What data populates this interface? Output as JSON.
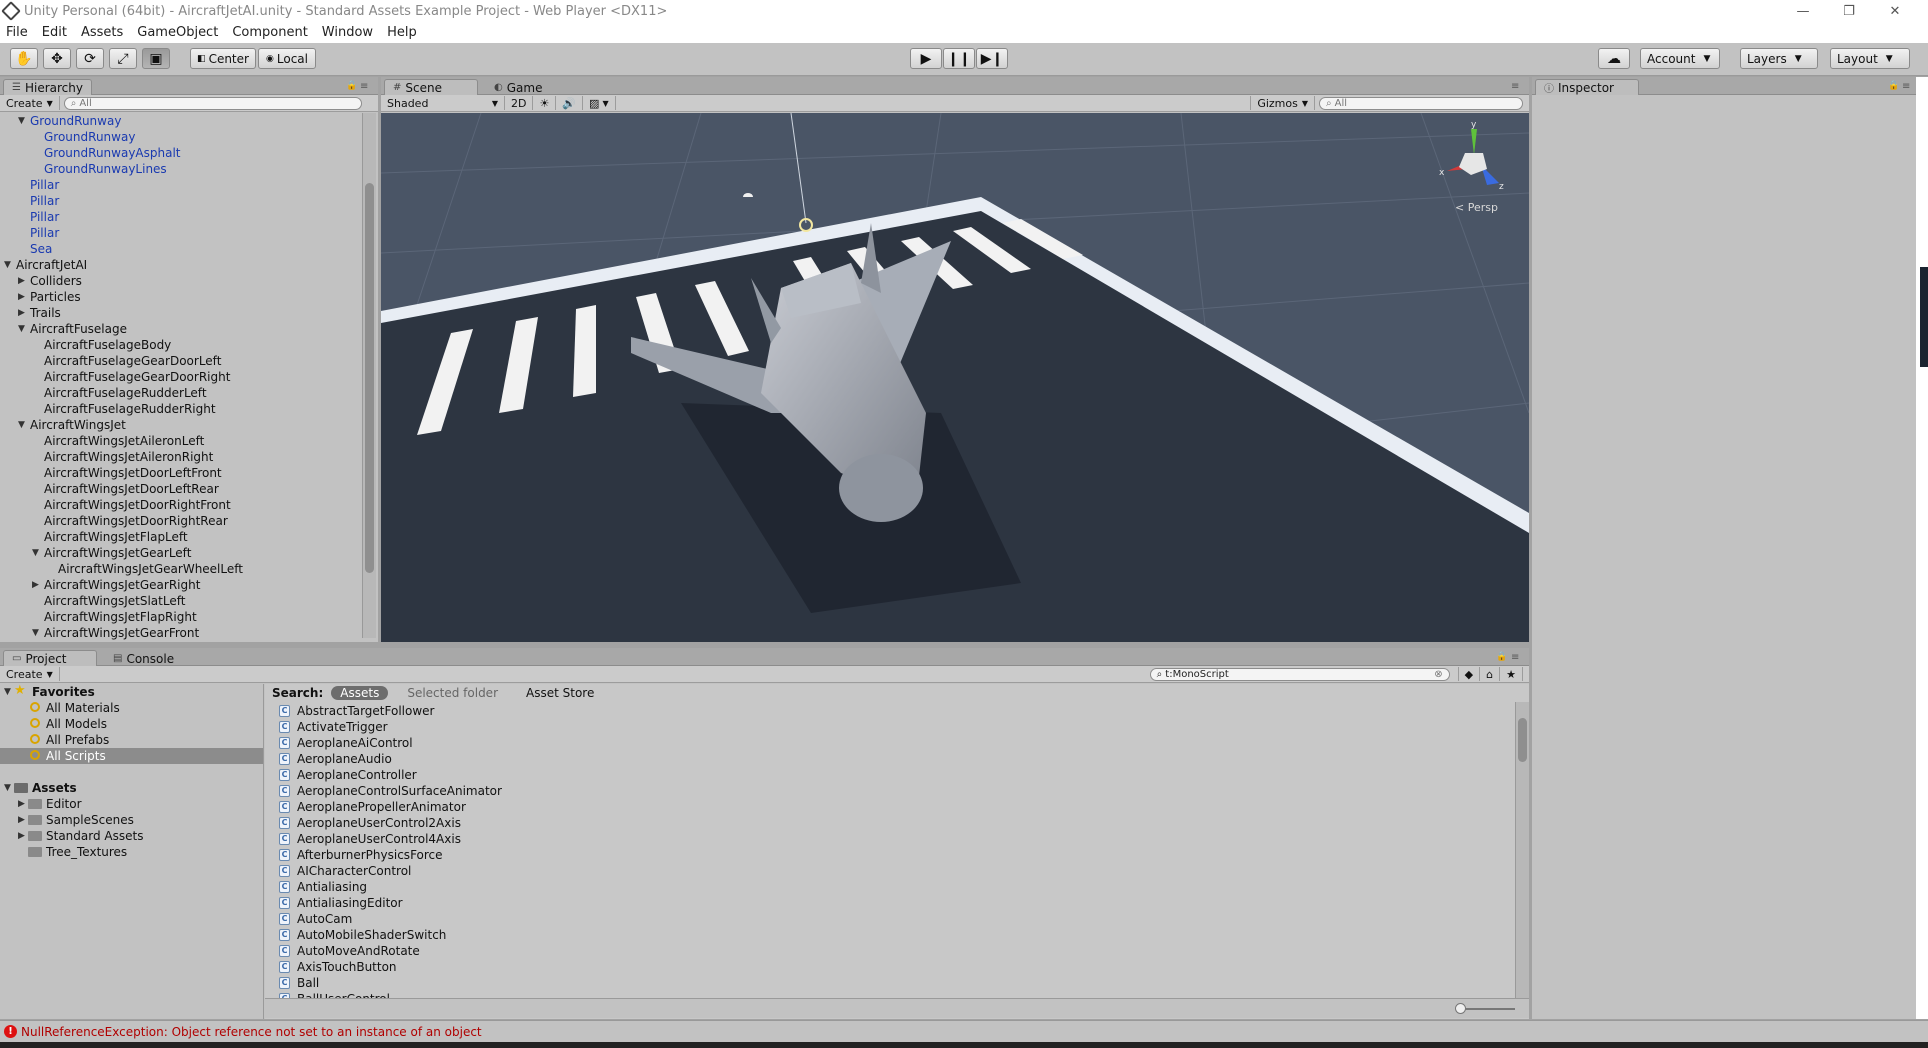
{
  "window": {
    "title": "Unity Personal (64bit) - AircraftJetAI.unity - Standard Assets Example Project - Web Player <DX11>",
    "minimize": "—",
    "restore": "❐",
    "close": "✕"
  },
  "menu": [
    "File",
    "Edit",
    "Assets",
    "GameObject",
    "Component",
    "Window",
    "Help"
  ],
  "toolbar": {
    "pivot_center": "Center",
    "pivot_local": "Local",
    "account": "Account",
    "layers": "Layers",
    "layout": "Layout"
  },
  "hierarchy": {
    "tab": "Hierarchy",
    "create": "Create",
    "search_placeholder": "All",
    "rows": [
      {
        "label": "GroundRunway",
        "depth": 1,
        "fold": "open",
        "prefab": true
      },
      {
        "label": "GroundRunway",
        "depth": 2,
        "fold": "none",
        "prefab": true
      },
      {
        "label": "GroundRunwayAsphalt",
        "depth": 2,
        "fold": "none",
        "prefab": true
      },
      {
        "label": "GroundRunwayLines",
        "depth": 2,
        "fold": "none",
        "prefab": true
      },
      {
        "label": "Pillar",
        "depth": 1,
        "fold": "none",
        "prefab": true
      },
      {
        "label": "Pillar",
        "depth": 1,
        "fold": "none",
        "prefab": true
      },
      {
        "label": "Pillar",
        "depth": 1,
        "fold": "none",
        "prefab": true
      },
      {
        "label": "Pillar",
        "depth": 1,
        "fold": "none",
        "prefab": true
      },
      {
        "label": "Sea",
        "depth": 1,
        "fold": "none",
        "prefab": true
      },
      {
        "label": "AircraftJetAI",
        "depth": 0,
        "fold": "open",
        "prefab": false
      },
      {
        "label": "Colliders",
        "depth": 1,
        "fold": "closed",
        "prefab": false
      },
      {
        "label": "Particles",
        "depth": 1,
        "fold": "closed",
        "prefab": false
      },
      {
        "label": "Trails",
        "depth": 1,
        "fold": "closed",
        "prefab": false
      },
      {
        "label": "AircraftFuselage",
        "depth": 1,
        "fold": "open",
        "prefab": false
      },
      {
        "label": "AircraftFuselageBody",
        "depth": 2,
        "fold": "none",
        "prefab": false
      },
      {
        "label": "AircraftFuselageGearDoorLeft",
        "depth": 2,
        "fold": "none",
        "prefab": false
      },
      {
        "label": "AircraftFuselageGearDoorRight",
        "depth": 2,
        "fold": "none",
        "prefab": false
      },
      {
        "label": "AircraftFuselageRudderLeft",
        "depth": 2,
        "fold": "none",
        "prefab": false
      },
      {
        "label": "AircraftFuselageRudderRight",
        "depth": 2,
        "fold": "none",
        "prefab": false
      },
      {
        "label": "AircraftWingsJet",
        "depth": 1,
        "fold": "open",
        "prefab": false
      },
      {
        "label": "AircraftWingsJetAileronLeft",
        "depth": 2,
        "fold": "none",
        "prefab": false
      },
      {
        "label": "AircraftWingsJetAileronRight",
        "depth": 2,
        "fold": "none",
        "prefab": false
      },
      {
        "label": "AircraftWingsJetDoorLeftFront",
        "depth": 2,
        "fold": "none",
        "prefab": false
      },
      {
        "label": "AircraftWingsJetDoorLeftRear",
        "depth": 2,
        "fold": "none",
        "prefab": false
      },
      {
        "label": "AircraftWingsJetDoorRightFront",
        "depth": 2,
        "fold": "none",
        "prefab": false
      },
      {
        "label": "AircraftWingsJetDoorRightRear",
        "depth": 2,
        "fold": "none",
        "prefab": false
      },
      {
        "label": "AircraftWingsJetFlapLeft",
        "depth": 2,
        "fold": "none",
        "prefab": false
      },
      {
        "label": "AircraftWingsJetGearLeft",
        "depth": 2,
        "fold": "open",
        "prefab": false
      },
      {
        "label": "AircraftWingsJetGearWheelLeft",
        "depth": 3,
        "fold": "none",
        "prefab": false
      },
      {
        "label": "AircraftWingsJetGearRight",
        "depth": 2,
        "fold": "closed",
        "prefab": false
      },
      {
        "label": "AircraftWingsJetSlatLeft",
        "depth": 2,
        "fold": "none",
        "prefab": false
      },
      {
        "label": "AircraftWingsJetFlapRight",
        "depth": 2,
        "fold": "none",
        "prefab": false
      },
      {
        "label": "AircraftWingsJetGearFront",
        "depth": 2,
        "fold": "open",
        "prefab": false
      }
    ]
  },
  "scene": {
    "tab_scene": "Scene",
    "tab_game": "Game",
    "shading": "Shaded",
    "mode_2d": "2D",
    "gizmos": "Gizmos",
    "search_placeholder": "All",
    "persp": "Persp",
    "axis_x": "x",
    "axis_y": "y",
    "axis_z": "z"
  },
  "inspector": {
    "tab": "Inspector"
  },
  "project": {
    "tab_project": "Project",
    "tab_console": "Console",
    "create": "Create",
    "search_value": "t:MonoScript",
    "search_label": "Search:",
    "scope_assets": "Assets",
    "scope_selected": "Selected folder",
    "scope_store": "Asset Store",
    "favorites_label": "Favorites",
    "favorites": [
      "All Materials",
      "All Models",
      "All Prefabs",
      "All Scripts"
    ],
    "assets_label": "Assets",
    "folders": [
      {
        "label": "Editor",
        "fold": "closed"
      },
      {
        "label": "SampleScenes",
        "fold": "closed"
      },
      {
        "label": "Standard Assets",
        "fold": "closed"
      },
      {
        "label": "Tree_Textures",
        "fold": "none"
      }
    ],
    "scripts": [
      "AbstractTargetFollower",
      "ActivateTrigger",
      "AeroplaneAiControl",
      "AeroplaneAudio",
      "AeroplaneController",
      "AeroplaneControlSurfaceAnimator",
      "AeroplanePropellerAnimator",
      "AeroplaneUserControl2Axis",
      "AeroplaneUserControl4Axis",
      "AfterburnerPhysicsForce",
      "AICharacterControl",
      "Antialiasing",
      "AntialiasingEditor",
      "AutoCam",
      "AutoMobileShaderSwitch",
      "AutoMoveAndRotate",
      "AxisTouchButton",
      "Ball",
      "BallUserControl"
    ]
  },
  "status": {
    "message": "NullReferenceException: Object reference not set to an instance of an object"
  },
  "colors": {
    "scene_bg": "#4a5566",
    "runway": "#2d3541",
    "prefab_text": "#1a3ab0",
    "error": "#b00000"
  }
}
